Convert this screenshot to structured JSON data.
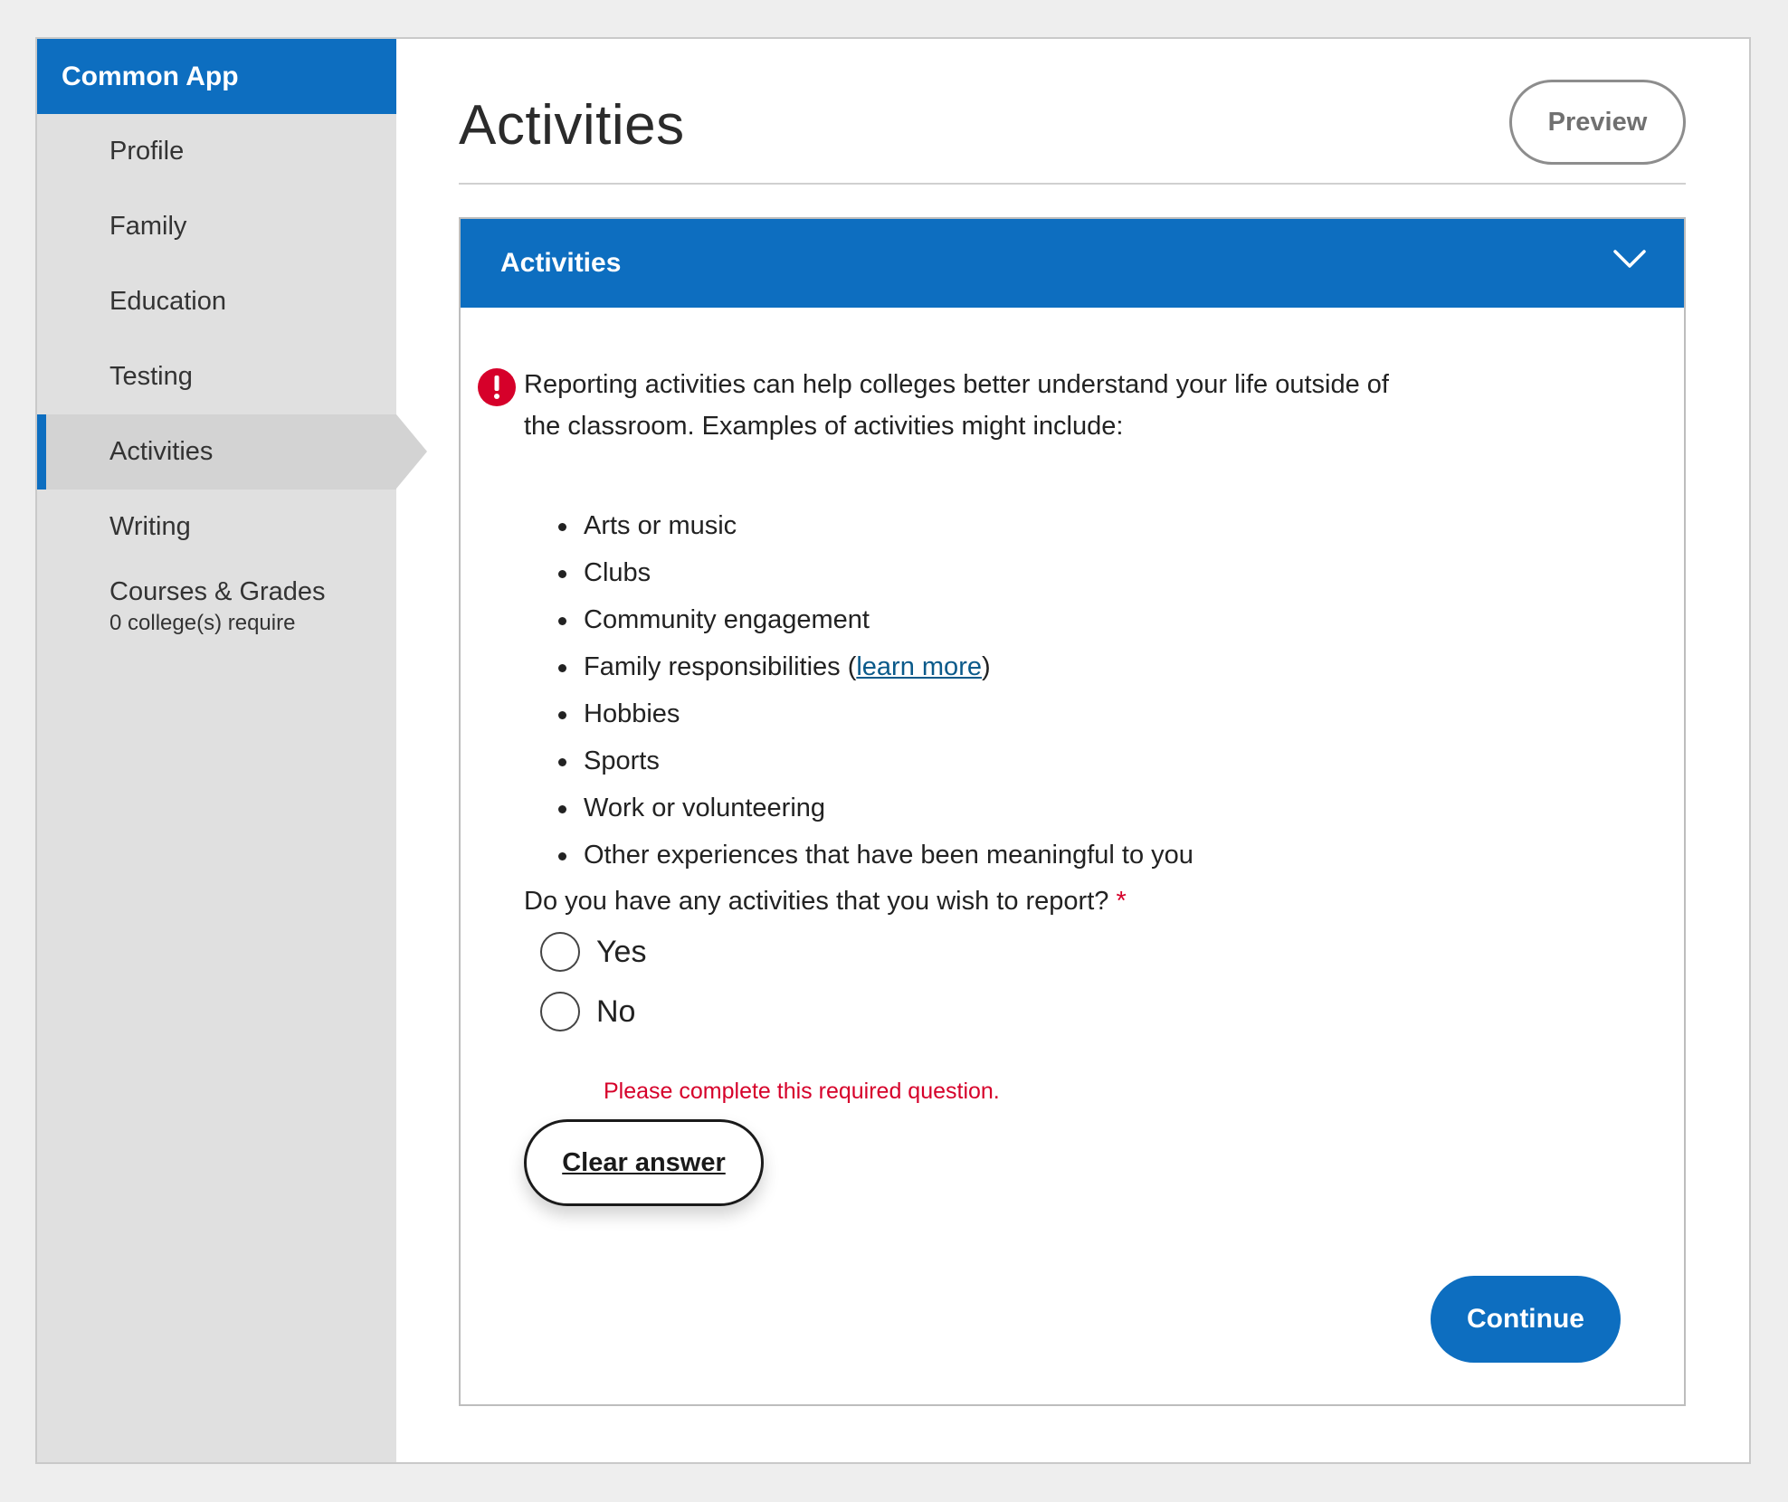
{
  "sidebar": {
    "brand": "Common App",
    "items": [
      {
        "label": "Profile"
      },
      {
        "label": "Family"
      },
      {
        "label": "Education"
      },
      {
        "label": "Testing"
      },
      {
        "label": "Activities",
        "active": true
      },
      {
        "label": "Writing"
      },
      {
        "label": "Courses & Grades",
        "sub": "0 college(s) require"
      }
    ]
  },
  "header": {
    "title": "Activities",
    "preview_label": "Preview"
  },
  "section": {
    "title": "Activities",
    "intro_line1": "Reporting activities can help colleges better understand your life outside of",
    "intro_line2": "the classroom. Examples of activities might include:",
    "examples": [
      "Arts or music",
      "Clubs",
      "Community engagement",
      "Family responsibilities (",
      "Hobbies",
      "Sports",
      "Work or volunteering",
      "Other experiences that have been meaningful to you"
    ],
    "learn_more": "learn more",
    "learn_more_close": ")",
    "question": "Do you have any activities that you wish to report?",
    "required_mark": "*",
    "options": [
      "Yes",
      "No"
    ],
    "error": "Please complete this required question.",
    "clear_label": "Clear answer",
    "continue_label": "Continue"
  },
  "colors": {
    "brand_blue": "#0d6ec0",
    "error_red": "#d6002a",
    "sidebar_bg": "#e0e0e0"
  },
  "icons": {
    "section_toggle": "chevron-down-icon",
    "alert": "error-icon"
  }
}
